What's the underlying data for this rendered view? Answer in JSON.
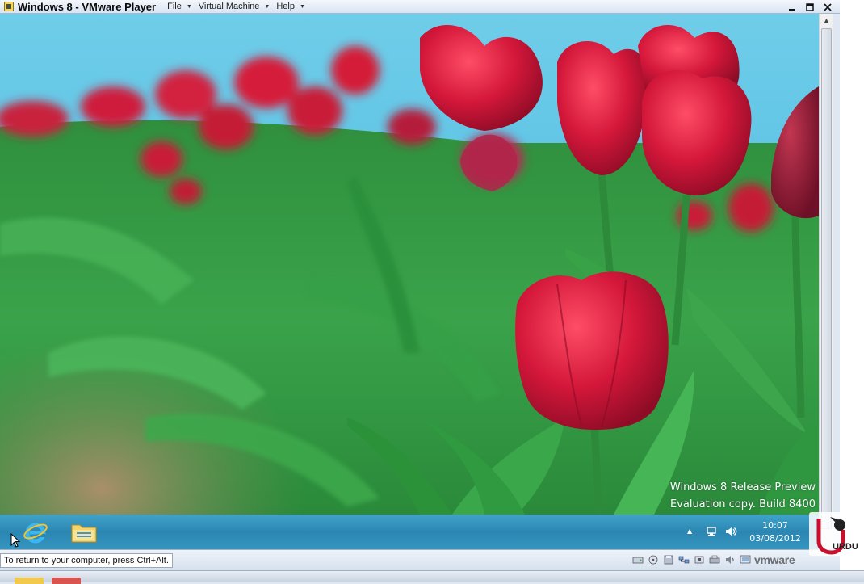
{
  "window": {
    "title": "Windows 8 - VMware Player",
    "menus": [
      "File",
      "Virtual Machine",
      "Help"
    ]
  },
  "vm": {
    "watermark_line1": "Windows 8 Release Preview",
    "watermark_line2": "Evaluation copy. Build 8400"
  },
  "taskbar": {
    "clock_time": "10:07",
    "clock_date": "03/08/2012"
  },
  "statusbar": {
    "hint": "To return to your computer, press Ctrl+Alt.",
    "logo": "vmware"
  },
  "brand": {
    "logo_text": "URDU"
  },
  "colors": {
    "taskbar": "#2b86b2",
    "sky": "#5cc4e6",
    "tulip_red": "#d8183a",
    "leaf_green": "#2d9a3d"
  },
  "icons": [
    "vmware-app-icon",
    "minimize-icon",
    "maximize-icon",
    "close-icon",
    "internet-explorer-icon",
    "file-explorer-icon",
    "show-hidden-icons-icon",
    "network-icon",
    "volume-icon",
    "mouse-cursor-icon",
    "scroll-up-icon"
  ]
}
